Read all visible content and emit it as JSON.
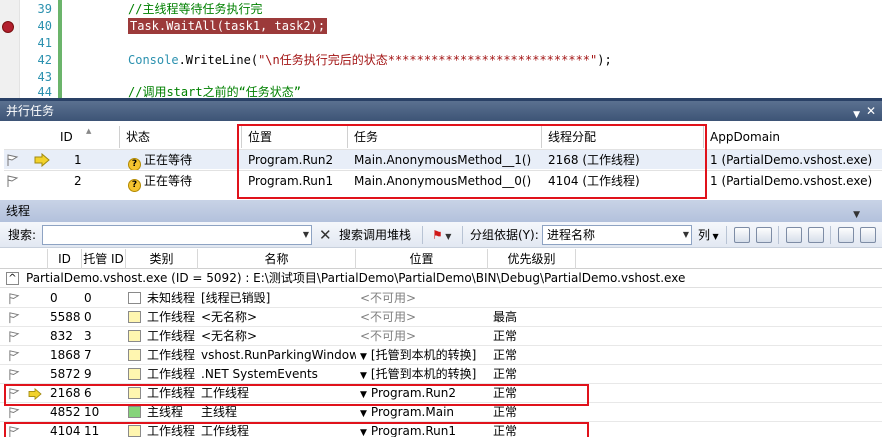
{
  "editor": {
    "lines": [
      {
        "num": "39",
        "text": "//主线程等待任务执行完",
        "kind": "comment"
      },
      {
        "num": "40",
        "text": "Task.WaitAll(task1, task2);",
        "kind": "highlight"
      },
      {
        "num": "41",
        "text": "",
        "kind": "blank"
      },
      {
        "num": "42",
        "type": "Console",
        "text": ".WriteLine(",
        "str": "\"\\n任务执行完后的状态****************************\"",
        "tail": ");",
        "kind": "console"
      },
      {
        "num": "43",
        "text": "",
        "kind": "blank"
      },
      {
        "num": "44",
        "text": "//调用start之前的“任务状态”",
        "kind": "comment"
      }
    ]
  },
  "tasks_panel": {
    "title": "并行任务",
    "columns": [
      "ID",
      "状态",
      "位置",
      "任务",
      "线程分配",
      "AppDomain"
    ],
    "rows": [
      {
        "id": "1",
        "status": "正在等待",
        "location": "Program.Run2",
        "task": "Main.AnonymousMethod__1()",
        "thread": "2168 (工作线程)",
        "appdomain": "1 (PartialDemo.vshost.exe)",
        "current": true
      },
      {
        "id": "2",
        "status": "正在等待",
        "location": "Program.Run1",
        "task": "Main.AnonymousMethod__0()",
        "thread": "4104 (工作线程)",
        "appdomain": "1 (PartialDemo.vshost.exe)",
        "current": false
      }
    ]
  },
  "threads_panel": {
    "title": "线程",
    "toolbar": {
      "search_label": "搜索:",
      "search_value": "",
      "search_callstack": "搜索调用堆栈",
      "group_by_label": "分组依据(Y):",
      "group_by_value": "进程名称",
      "columns_label": "列"
    },
    "columns": [
      "ID",
      "托管 ID",
      "类别",
      "名称",
      "位置",
      "优先级别"
    ],
    "group_row": "PartialDemo.vshost.exe (ID = 5092) : E:\\测试项目\\PartialDemo\\PartialDemo\\BIN\\Debug\\PartialDemo.vshost.exe",
    "rows": [
      {
        "id": "0",
        "managed": "0",
        "category": "未知线程",
        "name": "[线程已销毁]",
        "location": "<不可用>",
        "priority": "",
        "cat_color": "#ffffff",
        "loc_gray": true,
        "chev": false,
        "current": false
      },
      {
        "id": "5588",
        "managed": "0",
        "category": "工作线程",
        "name": "<无名称>",
        "location": "<不可用>",
        "priority": "最高",
        "cat_color": "#fff6b0",
        "loc_gray": true,
        "chev": false,
        "current": false
      },
      {
        "id": "832",
        "managed": "3",
        "category": "工作线程",
        "name": "<无名称>",
        "location": "<不可用>",
        "priority": "正常",
        "cat_color": "#fff6b0",
        "loc_gray": true,
        "chev": false,
        "current": false
      },
      {
        "id": "1868",
        "managed": "7",
        "category": "工作线程",
        "name": "vshost.RunParkingWindow",
        "location": "[托管到本机的转换]",
        "priority": "正常",
        "cat_color": "#fff6b0",
        "loc_gray": false,
        "chev": true,
        "current": false
      },
      {
        "id": "5872",
        "managed": "9",
        "category": "工作线程",
        "name": ".NET SystemEvents",
        "location": "[托管到本机的转换]",
        "priority": "正常",
        "cat_color": "#fff6b0",
        "loc_gray": false,
        "chev": true,
        "current": false
      },
      {
        "id": "2168",
        "managed": "6",
        "category": "工作线程",
        "name": "工作线程",
        "location": "Program.Run2",
        "priority": "正常",
        "cat_color": "#fff6b0",
        "loc_gray": false,
        "chev": true,
        "current": true
      },
      {
        "id": "4852",
        "managed": "10",
        "category": "主线程",
        "name": "主线程",
        "location": "Program.Main",
        "priority": "正常",
        "cat_color": "#86d47a",
        "loc_gray": false,
        "chev": true,
        "current": false
      },
      {
        "id": "4104",
        "managed": "11",
        "category": "工作线程",
        "name": "工作线程",
        "location": "Program.Run1",
        "priority": "正常",
        "cat_color": "#fff6b0",
        "loc_gray": false,
        "chev": true,
        "current": false
      }
    ]
  },
  "colors": {
    "highlight_red": "#e0121b",
    "breakpoint": "#b21f2e",
    "current_arrow": "#f2d22b"
  }
}
